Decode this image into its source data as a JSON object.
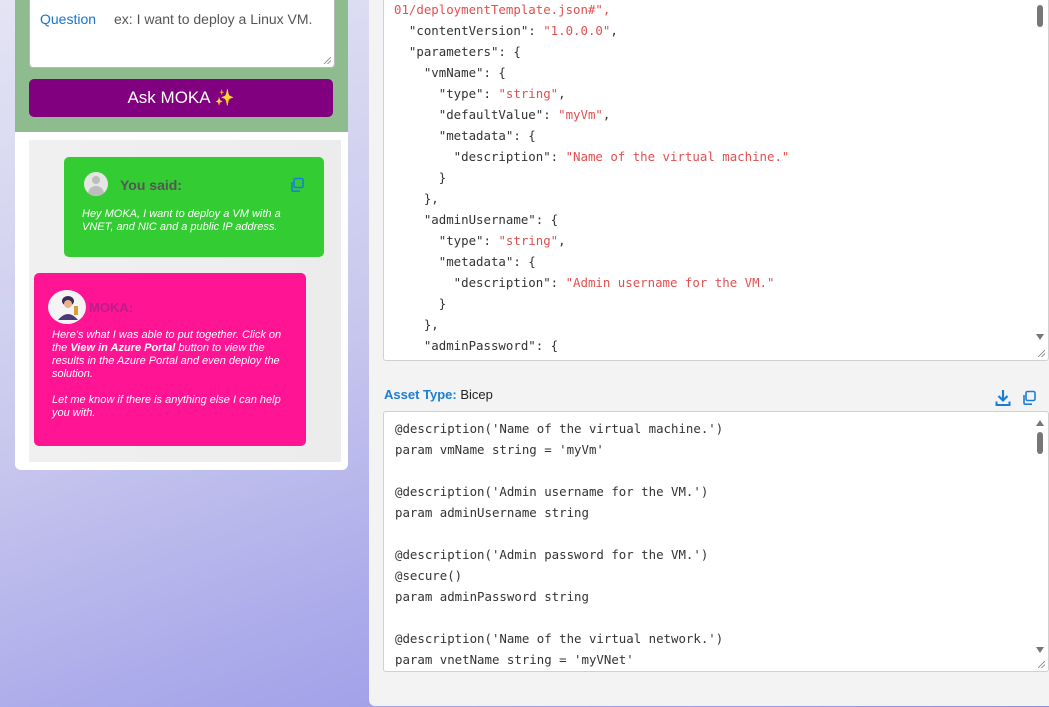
{
  "question": {
    "label": "Question",
    "placeholder": "ex: I want to deploy a Linux VM."
  },
  "ask_button": {
    "label": "Ask MOKA",
    "icon": "sparkles-icon"
  },
  "chat": {
    "user": {
      "heading": "You said:",
      "message": "Hey MOKA, I want to deploy a VM with a VNET, and NIC and a public IP address."
    },
    "moka": {
      "name": "MOKA:",
      "message_prefix": "Here's what I was able to put together. Click on the ",
      "message_link": "View in Azure Portal",
      "message_suffix": " button to view the results in the Azure Portal and even deploy the solution.",
      "message_2": "Let me know if there is anything else I can help you with."
    }
  },
  "json_lines": [
    {
      "k": "01/deploymentTemplate.json#\",",
      "cls": "str",
      "raw": true
    },
    {
      "k": "  \"contentVersion\": ",
      "v": "\"1.0.0.0\"",
      "e": ","
    },
    {
      "k": "  \"parameters\": {"
    },
    {
      "k": "    \"vmName\": {"
    },
    {
      "k": "      \"type\": ",
      "v": "\"string\"",
      "e": ","
    },
    {
      "k": "      \"defaultValue\": ",
      "v": "\"myVm\"",
      "e": ","
    },
    {
      "k": "      \"metadata\": {"
    },
    {
      "k": "        \"description\": ",
      "v": "\"Name of the virtual machine.\""
    },
    {
      "k": "      }"
    },
    {
      "k": "    },"
    },
    {
      "k": "    \"adminUsername\": {"
    },
    {
      "k": "      \"type\": ",
      "v": "\"string\"",
      "e": ","
    },
    {
      "k": "      \"metadata\": {"
    },
    {
      "k": "        \"description\": ",
      "v": "\"Admin username for the VM.\""
    },
    {
      "k": "      }"
    },
    {
      "k": "    },"
    },
    {
      "k": "    \"adminPassword\": {"
    }
  ],
  "asset": {
    "label": "Asset Type:",
    "value": "Bicep"
  },
  "bicep_lines": [
    "@description('Name of the virtual machine.')",
    "param vmName string = 'myVm'",
    "",
    "@description('Admin username for the VM.')",
    "param adminUsername string",
    "",
    "@description('Admin password for the VM.')",
    "@secure()",
    "param adminPassword string",
    "",
    "@description('Name of the virtual network.')",
    "param vnetName string = 'myVNet'"
  ],
  "colors": {
    "ask_button": "#800080",
    "ask_panel": "#8fbc8f",
    "user_card": "#33cc33",
    "moka_card": "#ff1493",
    "accent_blue": "#1a7fd4",
    "string_red": "#e05050"
  }
}
